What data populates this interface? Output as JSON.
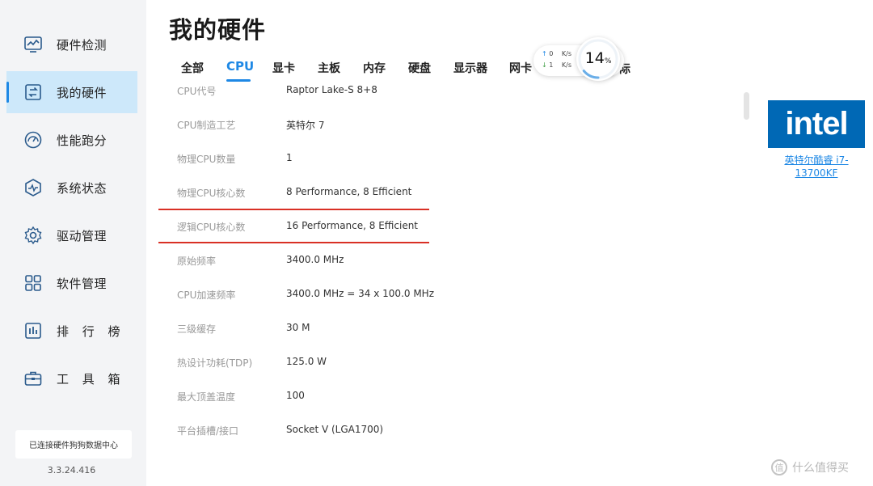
{
  "sidebar": {
    "items": [
      {
        "label": "硬件检测",
        "icon": "monitor-chart-icon",
        "active": false
      },
      {
        "label": "我的硬件",
        "icon": "chip-swap-icon",
        "active": true
      },
      {
        "label": "性能跑分",
        "icon": "speedometer-icon",
        "active": false
      },
      {
        "label": "系统状态",
        "icon": "shield-pulse-icon",
        "active": false
      },
      {
        "label": "驱动管理",
        "icon": "gear-icon",
        "active": false
      },
      {
        "label": "软件管理",
        "icon": "apps-grid-icon",
        "active": false
      },
      {
        "label": "排 行 榜",
        "icon": "bar-chart-icon",
        "active": false
      },
      {
        "label": "工 具 箱",
        "icon": "toolbox-icon",
        "active": false
      }
    ],
    "status": "已连接硬件狗狗数据中心",
    "version": "3.3.24.416"
  },
  "main": {
    "title": "我的硬件",
    "tabs": [
      "全部",
      "CPU",
      "显卡",
      "主板",
      "内存",
      "硬盘",
      "显示器",
      "网卡"
    ],
    "active_tab": "CPU",
    "hidden_tab_fragment": "际"
  },
  "net_widget": {
    "upload_value": "0",
    "upload_unit": "K/s",
    "download_value": "1",
    "download_unit": "K/s",
    "cpu_usage": "14",
    "cpu_usage_unit": "%"
  },
  "specs": [
    {
      "key": "CPU代号",
      "value": "Raptor Lake-S 8+8"
    },
    {
      "key": "CPU制造工艺",
      "value": "英特尔 7"
    },
    {
      "key": "物理CPU数量",
      "value": "1"
    },
    {
      "key": "物理CPU核心数",
      "value": "8 Performance, 8 Efficient"
    },
    {
      "key": "逻辑CPU核心数",
      "value": "16 Performance, 8 Efficient"
    },
    {
      "key": "原始频率",
      "value": "3400.0 MHz"
    },
    {
      "key": "CPU加速频率",
      "value": "3400.0 MHz = 34 x 100.0 MHz"
    },
    {
      "key": "三级缓存",
      "value": "30 M"
    },
    {
      "key": "热设计功耗(TDP)",
      "value": "125.0 W"
    },
    {
      "key": "最大顶盖温度",
      "value": "100"
    },
    {
      "key": "平台插槽/接口",
      "value": "Socket V (LGA1700)"
    }
  ],
  "cpu_card": {
    "brand_logo_text": "intel",
    "brand_color": "#0068b5",
    "name": "英特尔酷睿 i7-13700KF"
  },
  "watermark": {
    "icon": "值",
    "text": "什么值得买"
  },
  "colors": {
    "accent": "#1e88e5",
    "active_nav_bg": "#cde8fa",
    "highlight_line": "#d93025"
  }
}
